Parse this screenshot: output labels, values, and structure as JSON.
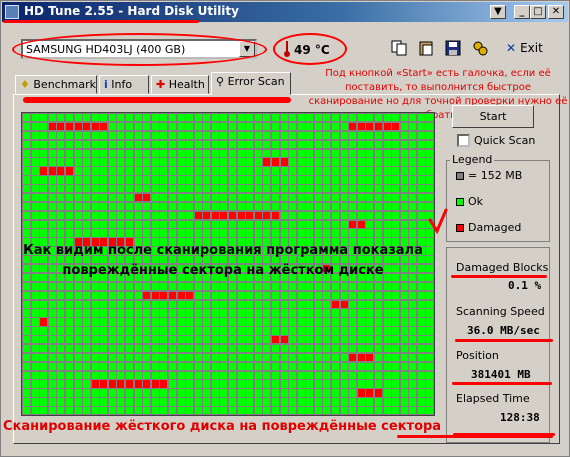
{
  "window": {
    "title": "HD Tune 2.55 - Hard Disk Utility",
    "controls": [
      "▼",
      "_",
      "□",
      "✕"
    ]
  },
  "toolbar": {
    "drive": "SAMSUNG HD403LJ (400 GB)",
    "temperature": "49 °C",
    "exit_label": "Exit"
  },
  "note": "Под кнопкой «Start» есть галочка, если её поставить, то выполнится быстрое сканирование но для точной проверки нужно её убрать",
  "tabs": [
    {
      "label": "Benchmark",
      "icon": "benchmark-icon"
    },
    {
      "label": "Info",
      "icon": "info-icon"
    },
    {
      "label": "Health",
      "icon": "health-icon"
    },
    {
      "label": "Error Scan",
      "icon": "magnifier-icon"
    }
  ],
  "scan": {
    "start_label": "Start",
    "quick_scan_label": "Quick Scan",
    "quick_scan_checked": false,
    "grid_cols": 48,
    "grid_rows": 34,
    "damaged_cells": [
      [
        1,
        3
      ],
      [
        1,
        4
      ],
      [
        1,
        5
      ],
      [
        1,
        6
      ],
      [
        1,
        7
      ],
      [
        1,
        8
      ],
      [
        1,
        9
      ],
      [
        1,
        38
      ],
      [
        1,
        39
      ],
      [
        1,
        40
      ],
      [
        1,
        41
      ],
      [
        1,
        42
      ],
      [
        1,
        43
      ],
      [
        5,
        28
      ],
      [
        5,
        29
      ],
      [
        5,
        30
      ],
      [
        6,
        2
      ],
      [
        6,
        3
      ],
      [
        6,
        4
      ],
      [
        6,
        5
      ],
      [
        9,
        13
      ],
      [
        9,
        14
      ],
      [
        11,
        20
      ],
      [
        11,
        21
      ],
      [
        11,
        22
      ],
      [
        11,
        23
      ],
      [
        11,
        24
      ],
      [
        11,
        25
      ],
      [
        11,
        26
      ],
      [
        11,
        27
      ],
      [
        11,
        28
      ],
      [
        11,
        29
      ],
      [
        12,
        38
      ],
      [
        12,
        39
      ],
      [
        14,
        6
      ],
      [
        14,
        7
      ],
      [
        14,
        8
      ],
      [
        14,
        9
      ],
      [
        14,
        10
      ],
      [
        14,
        11
      ],
      [
        14,
        12
      ],
      [
        17,
        35
      ],
      [
        20,
        14
      ],
      [
        20,
        15
      ],
      [
        20,
        16
      ],
      [
        20,
        17
      ],
      [
        20,
        18
      ],
      [
        20,
        19
      ],
      [
        21,
        36
      ],
      [
        21,
        37
      ],
      [
        23,
        2
      ],
      [
        25,
        29
      ],
      [
        25,
        30
      ],
      [
        27,
        38
      ],
      [
        27,
        39
      ],
      [
        27,
        40
      ],
      [
        30,
        8
      ],
      [
        30,
        9
      ],
      [
        30,
        10
      ],
      [
        30,
        11
      ],
      [
        30,
        12
      ],
      [
        30,
        13
      ],
      [
        30,
        14
      ],
      [
        30,
        15
      ],
      [
        30,
        16
      ],
      [
        31,
        39
      ],
      [
        31,
        40
      ],
      [
        31,
        41
      ]
    ]
  },
  "caption": [
    "Как видим после сканирования программа показала",
    "повреждённые сектора на жёстком диске"
  ],
  "legend": {
    "title": "Legend",
    "items": [
      {
        "label": "= 152 MB",
        "color": "#808080"
      },
      {
        "label": "Ok",
        "color": "#00ff00"
      },
      {
        "label": "Damaged",
        "color": "#ff0000"
      }
    ]
  },
  "stats": {
    "damaged_blocks_label": "Damaged Blocks",
    "damaged_blocks_value": "0.1 %",
    "scanning_speed_label": "Scanning Speed",
    "scanning_speed_value": "36.0 MB/sec",
    "position_label": "Position",
    "position_value": "381401 MB",
    "elapsed_label": "Elapsed Time",
    "elapsed_value": "128:38"
  },
  "bottom_caption": "Сканирование жёсткого диска на повреждённые сектора",
  "colors": {
    "ok": "#00ff00",
    "damaged": "#ff0000",
    "annotation": "#ff0000"
  }
}
